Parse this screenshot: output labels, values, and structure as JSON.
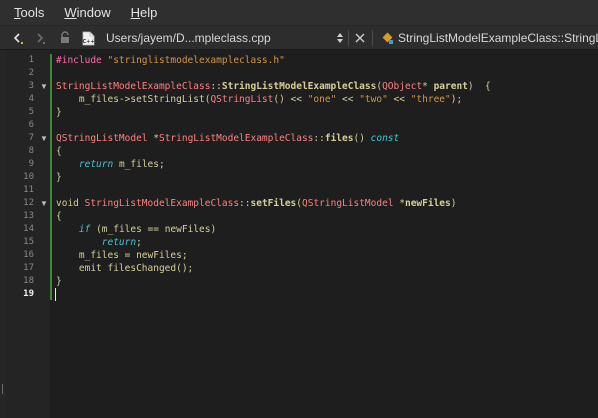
{
  "menu": [
    {
      "mnemonic": "T",
      "rest": "ools"
    },
    {
      "mnemonic": "W",
      "rest": "indow"
    },
    {
      "mnemonic": "H",
      "rest": "elp"
    }
  ],
  "toolbar": {
    "file_label": "Users/jayem/D...mpleclass.cpp",
    "symbol_label": "StringListModelExampleClass::StringListMo"
  },
  "editor": {
    "current_line": 19,
    "line_numbers": [
      "1",
      "2",
      "3",
      "4",
      "5",
      "6",
      "7",
      "8",
      "9",
      "10",
      "11",
      "12",
      "13",
      "14",
      "15",
      "16",
      "17",
      "18",
      "19"
    ],
    "code": [
      [
        {
          "t": "#include ",
          "c": "tok-pre"
        },
        {
          "t": "\"stringlistmodelexampleclass.h\"",
          "c": "tok-str"
        }
      ],
      [],
      [
        {
          "t": "StringListModelExampleClass",
          "c": "tok-type"
        },
        {
          "t": "::",
          "c": "tok-plain"
        },
        {
          "t": "StringListModelExampleClass",
          "c": "tok-fn"
        },
        {
          "t": "(",
          "c": "tok-plain"
        },
        {
          "t": "QObject",
          "c": "tok-type"
        },
        {
          "t": "* ",
          "c": "tok-plain"
        },
        {
          "t": "parent",
          "c": "tok-param"
        },
        {
          "t": ")  {",
          "c": "tok-plain"
        }
      ],
      [
        {
          "t": "    m_files->setStringList(",
          "c": "tok-plain"
        },
        {
          "t": "QStringList",
          "c": "tok-type"
        },
        {
          "t": "() << ",
          "c": "tok-plain"
        },
        {
          "t": "\"one\"",
          "c": "tok-str"
        },
        {
          "t": " << ",
          "c": "tok-plain"
        },
        {
          "t": "\"two\"",
          "c": "tok-str"
        },
        {
          "t": " << ",
          "c": "tok-plain"
        },
        {
          "t": "\"three\"",
          "c": "tok-str"
        },
        {
          "t": ");",
          "c": "tok-plain"
        }
      ],
      [
        {
          "t": "}",
          "c": "tok-plain"
        }
      ],
      [],
      [
        {
          "t": "QStringListModel",
          "c": "tok-type"
        },
        {
          "t": " *",
          "c": "tok-plain"
        },
        {
          "t": "StringListModelExampleClass",
          "c": "tok-type"
        },
        {
          "t": "::",
          "c": "tok-plain"
        },
        {
          "t": "files",
          "c": "tok-fn"
        },
        {
          "t": "() ",
          "c": "tok-plain"
        },
        {
          "t": "const",
          "c": "tok-kw"
        }
      ],
      [
        {
          "t": "{",
          "c": "tok-plain"
        }
      ],
      [
        {
          "t": "    ",
          "c": "tok-plain"
        },
        {
          "t": "return",
          "c": "tok-kw"
        },
        {
          "t": " m_files;",
          "c": "tok-plain"
        }
      ],
      [
        {
          "t": "}",
          "c": "tok-plain"
        }
      ],
      [],
      [
        {
          "t": "void ",
          "c": "tok-kw2"
        },
        {
          "t": "StringListModelExampleClass",
          "c": "tok-type"
        },
        {
          "t": "::",
          "c": "tok-plain"
        },
        {
          "t": "setFiles",
          "c": "tok-fn"
        },
        {
          "t": "(",
          "c": "tok-plain"
        },
        {
          "t": "QStringListModel",
          "c": "tok-type"
        },
        {
          "t": " *",
          "c": "tok-plain"
        },
        {
          "t": "newFiles",
          "c": "tok-param"
        },
        {
          "t": ")",
          "c": "tok-plain"
        }
      ],
      [
        {
          "t": "{",
          "c": "tok-plain"
        }
      ],
      [
        {
          "t": "    ",
          "c": "tok-plain"
        },
        {
          "t": "if",
          "c": "tok-kw"
        },
        {
          "t": " (m_files == newFiles)",
          "c": "tok-plain"
        }
      ],
      [
        {
          "t": "        ",
          "c": "tok-plain"
        },
        {
          "t": "return",
          "c": "tok-kw"
        },
        {
          "t": ";",
          "c": "tok-plain"
        }
      ],
      [
        {
          "t": "    m_files = newFiles;",
          "c": "tok-plain"
        }
      ],
      [
        {
          "t": "    emit filesChanged();",
          "c": "tok-plain"
        }
      ],
      [
        {
          "t": "}",
          "c": "tok-plain"
        }
      ],
      []
    ]
  },
  "colors": {
    "menubar_bg": "#2f2f2f",
    "editor_bg": "#1e1e1e",
    "gutter_bg": "#242424",
    "change_bar": "#3d8a3b",
    "type_color": "#ff8080",
    "string_color": "#d69545",
    "keyword_color": "#45c6d6",
    "preprocessor_color": "#ff6aad",
    "text_color": "#d6cf9a"
  },
  "icons": {
    "back": "back-arrow-icon",
    "forward": "forward-arrow-icon",
    "lock": "lock-icon",
    "file": "cpp-file-icon",
    "updown": "updown-chevron-icon",
    "close": "close-icon",
    "symbol": "symbol-icon"
  }
}
